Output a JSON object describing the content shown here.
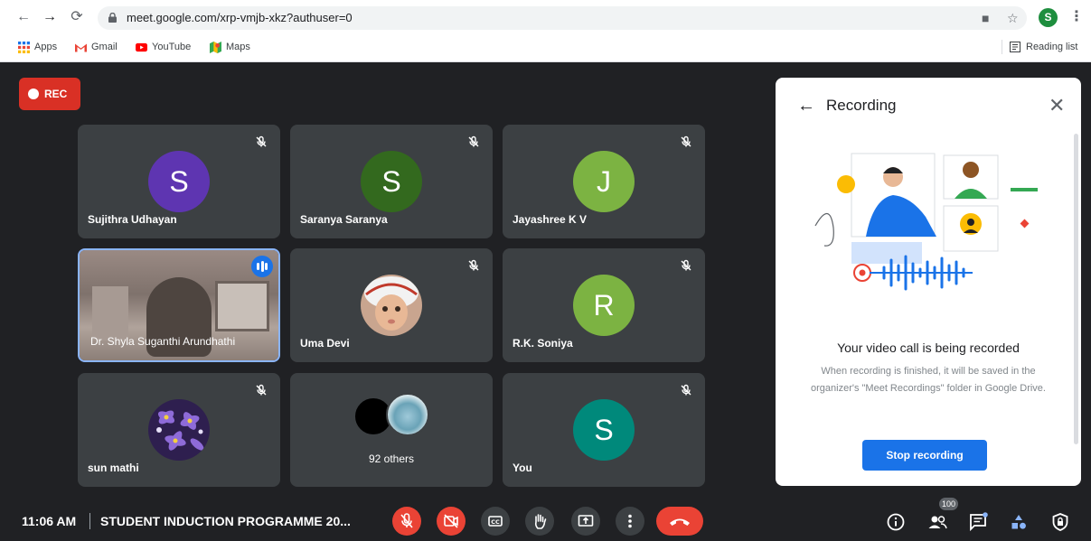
{
  "browser": {
    "url": "meet.google.com/xrp-vmjb-xkz?authuser=0",
    "profile_initial": "S",
    "bookmarks": [
      {
        "label": "Apps",
        "icon": "apps-grid-icon"
      },
      {
        "label": "Gmail",
        "icon": "gmail-icon"
      },
      {
        "label": "YouTube",
        "icon": "youtube-icon"
      },
      {
        "label": "Maps",
        "icon": "maps-icon"
      }
    ],
    "reading_list": "Reading list"
  },
  "meet": {
    "rec_label": "REC",
    "tiles": [
      {
        "name": "Sujithra Udhayan",
        "initial": "S",
        "color": "#5e35b1",
        "muted": true
      },
      {
        "name": "Saranya Saranya",
        "initial": "S",
        "color": "#33691e",
        "muted": true
      },
      {
        "name": "Jayashree K V",
        "initial": "J",
        "color": "#7cb342",
        "muted": true
      },
      {
        "name": "Dr. Shyla Suganthi Arundhathi",
        "video": true,
        "speaking": true
      },
      {
        "name": "Uma Devi",
        "photo": "baby-photo",
        "muted": true
      },
      {
        "name": "R.K. Soniya",
        "initial": "R",
        "color": "#7cb342",
        "muted": true
      },
      {
        "name": "sun mathi",
        "photo": "purple-flowers-photo",
        "muted": true
      },
      {
        "name": "92 others",
        "group": true
      },
      {
        "name": "You",
        "initial": "S",
        "color": "#00897b",
        "muted": true
      }
    ]
  },
  "panel": {
    "title": "Recording",
    "heading": "Your video call is being recorded",
    "description": "When recording is finished, it will be saved in the organizer's \"Meet Recordings\" folder in Google Drive.",
    "stop_button": "Stop recording"
  },
  "bottom_bar": {
    "time": "11:06 AM",
    "meeting_title": "STUDENT INDUCTION PROGRAMME 20...",
    "participant_count": "100"
  },
  "colors": {
    "rec_red": "#d93025",
    "accent_blue": "#1a73e8",
    "tile_bg": "#3c4043",
    "page_bg": "#202124"
  }
}
